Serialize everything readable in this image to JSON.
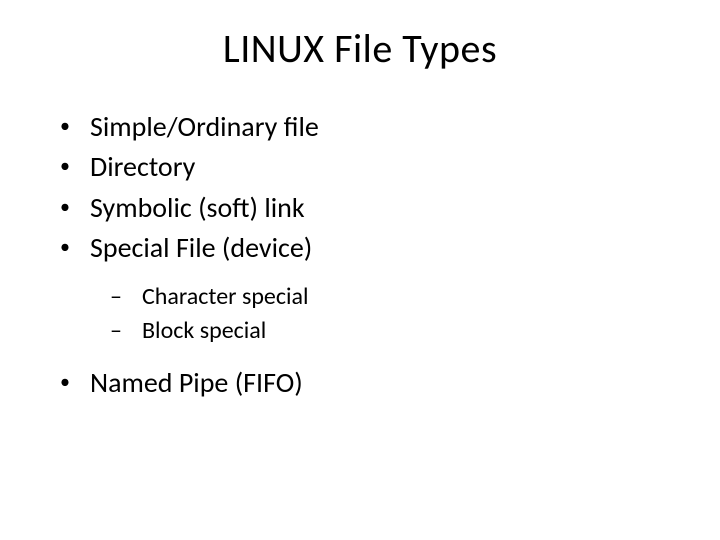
{
  "title": "LINUX File Types",
  "items": [
    "Simple/Ordinary file",
    "Directory",
    "Symbolic (soft) link",
    "Special File (device)"
  ],
  "subitems": [
    "Character special",
    "Block special"
  ],
  "items_after": [
    "Named Pipe (FIFO)"
  ]
}
